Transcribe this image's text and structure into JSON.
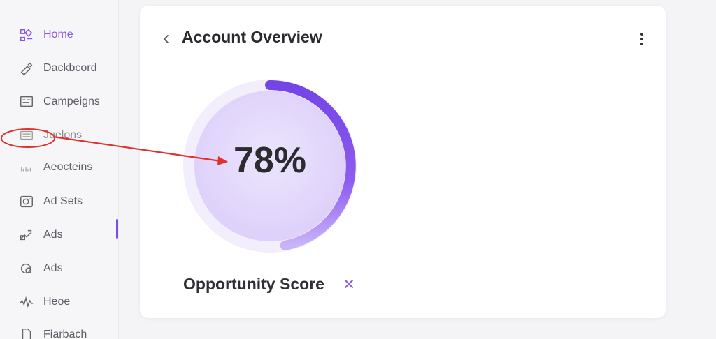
{
  "sidebar": {
    "items": [
      {
        "label": "Home",
        "icon": "home-icon",
        "active": true
      },
      {
        "label": "Dackbcord",
        "icon": "dashboard-icon"
      },
      {
        "label": "Campeigns",
        "icon": "campaigns-icon"
      },
      {
        "label": "Juelons",
        "icon": "juelons-icon"
      },
      {
        "label": "Aeocteins",
        "icon": "audiences-icon"
      },
      {
        "label": "Ad Sets",
        "icon": "ad-sets-icon"
      },
      {
        "label": "Ads",
        "icon": "ads-icon"
      },
      {
        "label": "Ads",
        "icon": "ads-alt-icon"
      },
      {
        "label": "Heoe",
        "icon": "pulse-icon"
      },
      {
        "label": "Fiarbach",
        "icon": "document-icon"
      }
    ]
  },
  "card": {
    "title": "Account Overview"
  },
  "gauge": {
    "value_text": "78%",
    "fraction": 0.78,
    "label": "Opportunity Score"
  },
  "colors": {
    "accent": "#7a4fe0",
    "accent_light": "#c6b0f7",
    "gauge_fill": "#e4dafc",
    "annotation": "#e0312f"
  }
}
